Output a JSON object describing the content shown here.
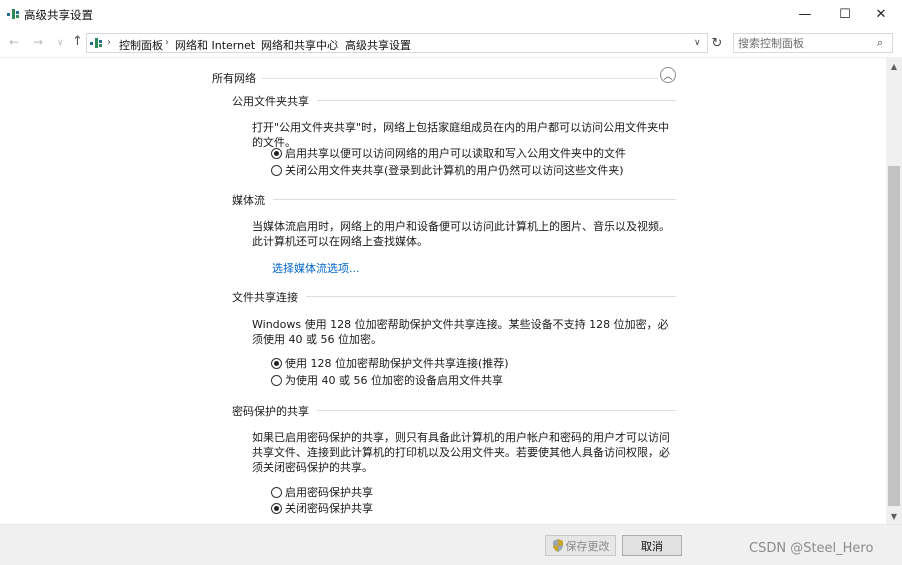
{
  "window": {
    "title": "高级共享设置",
    "min_glyph": "—",
    "max_glyph": "☐",
    "close_glyph": "✕"
  },
  "nav": {
    "back_glyph": "←",
    "forward_glyph": "→",
    "recent_glyph": "∨",
    "up_glyph": "↑",
    "refresh_glyph": "↻",
    "dropdown_glyph": "∨",
    "breadcrumbs": [
      "控制面板",
      "网络和 Internet",
      "网络和共享中心",
      "高级共享设置"
    ],
    "separator": "›",
    "search_placeholder": "搜索控制面板",
    "search_glyph": "⌕"
  },
  "section": {
    "title": "所有网络",
    "collapse_glyph": "︿"
  },
  "public_folder": {
    "title": "公用文件夹共享",
    "description": "打开\"公用文件夹共享\"时，网络上包括家庭组成员在内的用户都可以访问公用文件夹中的文件。",
    "options": [
      {
        "label": "启用共享以便可以访问网络的用户可以读取和写入公用文件夹中的文件",
        "checked": true
      },
      {
        "label": "关闭公用文件夹共享(登录到此计算机的用户仍然可以访问这些文件夹)",
        "checked": false
      }
    ]
  },
  "media": {
    "title": "媒体流",
    "description": "当媒体流启用时，网络上的用户和设备便可以访问此计算机上的图片、音乐以及视频。此计算机还可以在网络上查找媒体。",
    "link": "选择媒体流选项..."
  },
  "file_sharing": {
    "title": "文件共享连接",
    "description": "Windows 使用 128 位加密帮助保护文件共享连接。某些设备不支持 128 位加密，必须使用 40 或 56 位加密。",
    "options": [
      {
        "label": "使用 128 位加密帮助保护文件共享连接(推荐)",
        "checked": true
      },
      {
        "label": "为使用 40 或 56 位加密的设备启用文件共享",
        "checked": false
      }
    ]
  },
  "password": {
    "title": "密码保护的共享",
    "description": "如果已启用密码保护的共享，则只有具备此计算机的用户帐户和密码的用户才可以访问共享文件、连接到此计算机的打印机以及公用文件夹。若要使其他人具备访问权限，必须关闭密码保护的共享。",
    "options": [
      {
        "label": "启用密码保护共享",
        "checked": false
      },
      {
        "label": "关闭密码保护共享",
        "checked": true
      }
    ]
  },
  "scroll": {
    "up_glyph": "▲",
    "down_glyph": "▼"
  },
  "footer": {
    "save_label": "保存更改",
    "cancel_label": "取消",
    "watermark": "CSDN @Steel_Hero"
  },
  "colors": {
    "link": "#0066cc",
    "icon_green": "#2e8b57",
    "icon_teal": "#1f6f8b"
  }
}
